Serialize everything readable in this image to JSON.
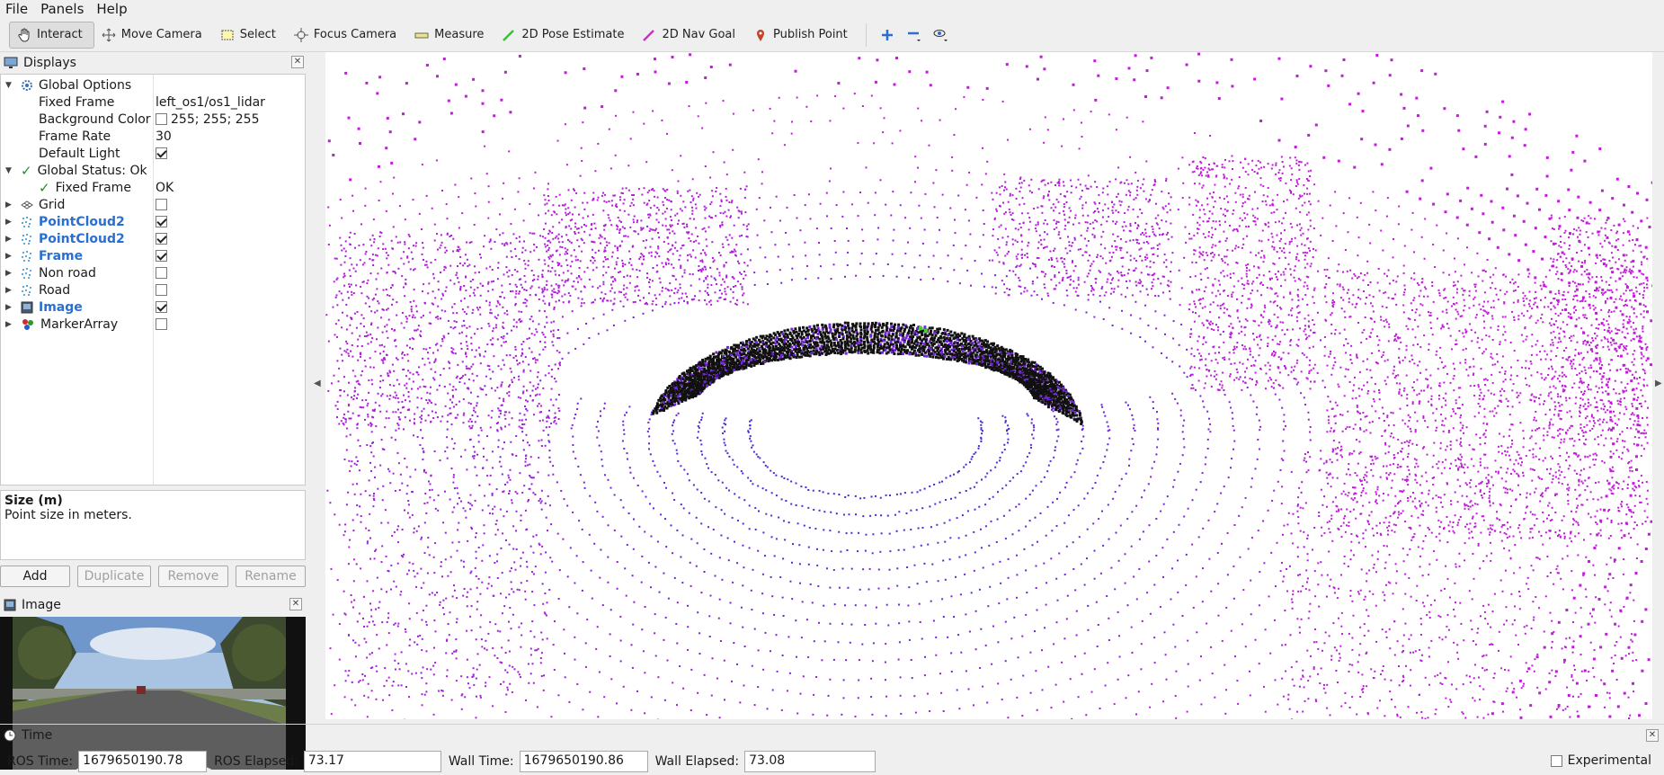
{
  "menu": {
    "file": "File",
    "panels": "Panels",
    "help": "Help"
  },
  "toolbar": {
    "interact": "Interact",
    "move_camera": "Move Camera",
    "select": "Select",
    "focus_camera": "Focus Camera",
    "measure": "Measure",
    "pose_estimate": "2D Pose Estimate",
    "nav_goal": "2D Nav Goal",
    "publish_point": "Publish Point"
  },
  "displays": {
    "title": "Displays",
    "global_options": "Global Options",
    "fixed_frame_label": "Fixed Frame",
    "fixed_frame_value": "left_os1/os1_lidar",
    "bg_color_label": "Background Color",
    "bg_color_value": "255; 255; 255",
    "frame_rate_label": "Frame Rate",
    "frame_rate_value": "30",
    "default_light_label": "Default Light",
    "global_status": "Global Status: Ok",
    "status_fixed_frame": "Fixed Frame",
    "status_fixed_frame_value": "OK",
    "items": [
      {
        "label": "Grid",
        "checked": false,
        "highlight": false
      },
      {
        "label": "PointCloud2",
        "checked": true,
        "highlight": true
      },
      {
        "label": "PointCloud2",
        "checked": true,
        "highlight": true
      },
      {
        "label": "Frame",
        "checked": true,
        "highlight": true
      },
      {
        "label": "Non road",
        "checked": false,
        "highlight": false
      },
      {
        "label": "Road",
        "checked": false,
        "highlight": false
      },
      {
        "label": "Image",
        "checked": true,
        "highlight": true
      },
      {
        "label": "MarkerArray",
        "checked": false,
        "highlight": false
      }
    ]
  },
  "description": {
    "title": "Size (m)",
    "text": "Point size in meters."
  },
  "buttons": {
    "add": "Add",
    "duplicate": "Duplicate",
    "remove": "Remove",
    "rename": "Rename"
  },
  "image_panel": {
    "title": "Image"
  },
  "time": {
    "title": "Time",
    "ros_time_label": "ROS Time:",
    "ros_time": "1679650190.78",
    "ros_elapsed_label": "ROS Elapsed:",
    "ros_elapsed": "73.17",
    "wall_time_label": "Wall Time:",
    "wall_time": "1679650190.86",
    "wall_elapsed_label": "Wall Elapsed:",
    "wall_elapsed": "73.08",
    "experimental": "Experimental"
  },
  "colors": {
    "highlight": "#2a6fd0",
    "cloud_near": "#3b2bd8",
    "cloud_far": "#c21bd9",
    "cloud_dark": "#111111"
  }
}
